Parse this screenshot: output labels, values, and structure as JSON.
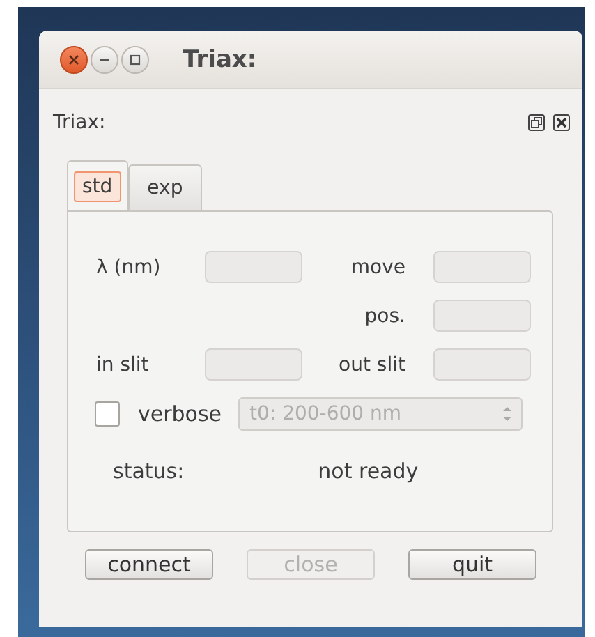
{
  "window": {
    "title": "Triax:"
  },
  "panel": {
    "title": "Triax:"
  },
  "tabs": [
    {
      "label": "std",
      "selected": true
    },
    {
      "label": "exp",
      "selected": false
    }
  ],
  "fields": [
    {
      "label": "λ (nm)",
      "kind": "field",
      "disabled": true
    },
    {
      "label": "move",
      "kind": "field",
      "disabled": true
    },
    {
      "kind": "empty"
    },
    {
      "label": "pos.",
      "kind": "field",
      "disabled": true
    },
    {
      "label": "in slit",
      "kind": "field",
      "disabled": true
    },
    {
      "label": "out slit",
      "kind": "field",
      "disabled": true
    }
  ],
  "verbose": {
    "label": "verbose",
    "checked": false
  },
  "range_select": {
    "value": "t0: 200-600 nm",
    "disabled": true
  },
  "status": {
    "label": "status:",
    "value": "not ready"
  },
  "buttons": [
    {
      "label": "connect",
      "disabled": false
    },
    {
      "label": "close",
      "disabled": true
    },
    {
      "label": "quit",
      "disabled": false
    }
  ]
}
